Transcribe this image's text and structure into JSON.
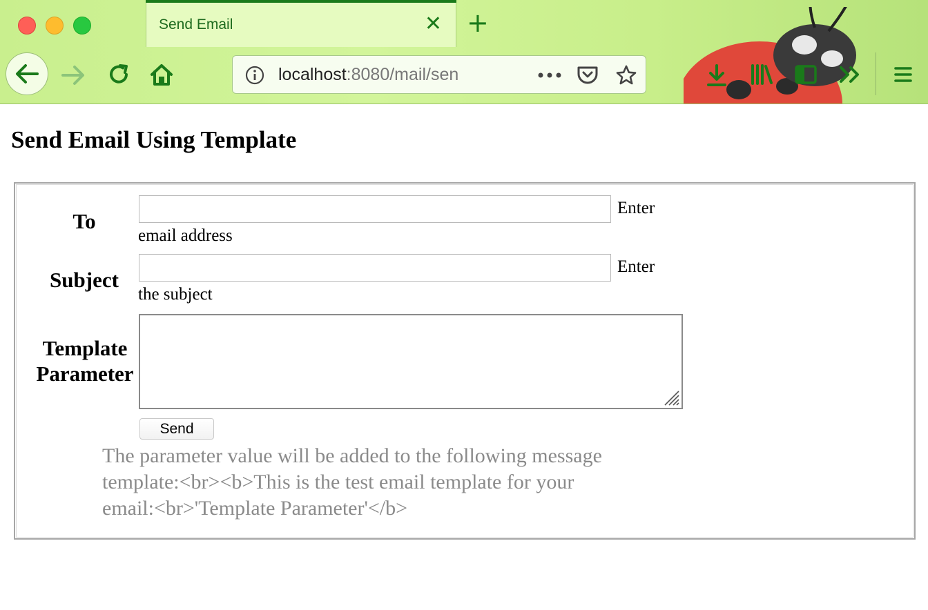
{
  "browser": {
    "tab_title": "Send Email",
    "url_host": "localhost",
    "url_rest": ":8080/mail/sen",
    "icons": [
      "close-icon",
      "plus-icon",
      "back-arrow-icon",
      "forward-arrow-icon",
      "reload-icon",
      "home-icon",
      "info-icon",
      "more-dots-icon",
      "pocket-icon",
      "star-icon",
      "download-icon",
      "library-icon",
      "sidebar-icon",
      "overflow-chevron-icon",
      "hamburger-menu-icon"
    ],
    "accent_color": "#1a7a1a"
  },
  "page": {
    "title": "Send Email Using Template"
  },
  "form": {
    "to_label": "To",
    "to_hint_line1": "Enter",
    "to_hint_line2": "email address",
    "subject_label": "Subject",
    "subject_hint_line1": "Enter",
    "subject_hint_line2": "the subject",
    "template_label_line1": "Template",
    "template_label_line2": "Parameter",
    "to_value": "",
    "subject_value": "",
    "template_value": "",
    "send_label": "Send",
    "note_line1": "The parameter value will be added to the following message",
    "note_line2": "template:<br><b>This is the test email template for your",
    "note_line3": "email:<br>'Template Parameter'</b>"
  }
}
